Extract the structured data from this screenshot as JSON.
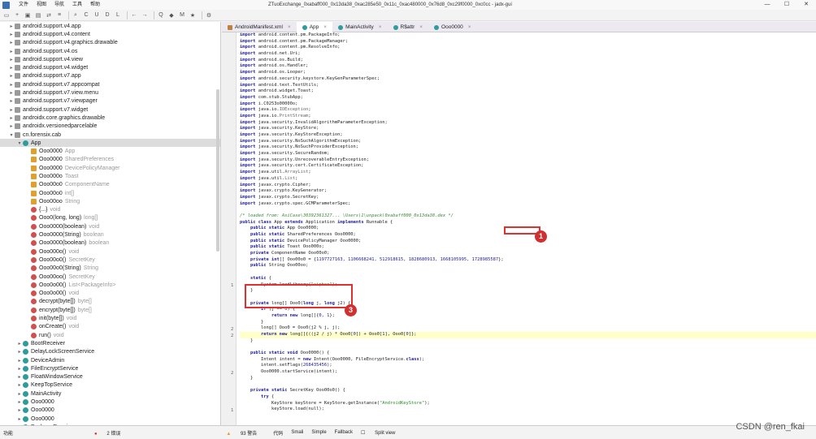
{
  "menu": [
    "文件",
    "视图",
    "导航",
    "工具",
    "帮助"
  ],
  "window_title": "ZTuoExchange_0xabaff000_0x13da38_0xac285e50_0x11c_0xac480000_0x76d8_0xc29f0000_0xc0cc - jadx-gui",
  "tabs": [
    {
      "label": "AndroidManifest.xml"
    },
    {
      "label": "App"
    },
    {
      "label": "MainActivity"
    },
    {
      "label": "R$attr"
    },
    {
      "label": "Ooo0000"
    }
  ],
  "tree": [
    {
      "label": "android.support.v4.app",
      "kind": "pkg",
      "depth": 1,
      "exp": ">"
    },
    {
      "label": "android.support.v4.content",
      "kind": "pkg",
      "depth": 1,
      "exp": ">"
    },
    {
      "label": "android.support.v4.graphics.drawable",
      "kind": "pkg",
      "depth": 1,
      "exp": ">"
    },
    {
      "label": "android.support.v4.os",
      "kind": "pkg",
      "depth": 1,
      "exp": ">"
    },
    {
      "label": "android.support.v4.view",
      "kind": "pkg",
      "depth": 1,
      "exp": ">"
    },
    {
      "label": "android.support.v4.widget",
      "kind": "pkg",
      "depth": 1,
      "exp": ">"
    },
    {
      "label": "android.support.v7.app",
      "kind": "pkg",
      "depth": 1,
      "exp": ">"
    },
    {
      "label": "android.support.v7.appcompat",
      "kind": "pkg",
      "depth": 1,
      "exp": ">"
    },
    {
      "label": "android.support.v7.view.menu",
      "kind": "pkg",
      "depth": 1,
      "exp": ">"
    },
    {
      "label": "android.support.v7.viewpager",
      "kind": "pkg",
      "depth": 1,
      "exp": ">"
    },
    {
      "label": "android.support.v7.widget",
      "kind": "pkg",
      "depth": 1,
      "exp": ">"
    },
    {
      "label": "androidx.core.graphics.drawable",
      "kind": "pkg",
      "depth": 1,
      "exp": ">"
    },
    {
      "label": "androidx.versionedparcelable",
      "kind": "pkg",
      "depth": 1,
      "exp": ">"
    },
    {
      "label": "cn.forensix.cab",
      "kind": "pkg",
      "depth": 1,
      "exp": "v"
    },
    {
      "label": "App",
      "kind": "cls",
      "depth": 2,
      "exp": "v",
      "sel": true
    },
    {
      "label": "Ooo0000",
      "type": "App",
      "kind": "fld",
      "depth": 3
    },
    {
      "label": "Ooo0000",
      "type": "SharedPreferences",
      "kind": "fld",
      "depth": 3
    },
    {
      "label": "Ooo0000",
      "type": "DevicePolicyManager",
      "kind": "fld",
      "depth": 3
    },
    {
      "label": "Ooo000o",
      "type": "Toast",
      "kind": "fld",
      "depth": 3
    },
    {
      "label": "Ooo00o0",
      "type": "ComponentName",
      "kind": "fld",
      "depth": 3
    },
    {
      "label": "Ooo00o0",
      "type": "int[]",
      "kind": "fld",
      "depth": 3
    },
    {
      "label": "Ooo00oo",
      "type": "String",
      "kind": "fld",
      "depth": 3
    },
    {
      "label": "{...}",
      "type": "void",
      "kind": "mth",
      "depth": 3
    },
    {
      "label": "Ooo0(long, long)",
      "type": "long[]",
      "kind": "mth",
      "depth": 3
    },
    {
      "label": "Ooo0000(boolean)",
      "type": "void",
      "kind": "mth",
      "depth": 3
    },
    {
      "label": "Ooo0000(String)",
      "type": "boolean",
      "kind": "mth",
      "depth": 3
    },
    {
      "label": "Ooo0000(boolean)",
      "type": "boolean",
      "kind": "mth",
      "depth": 3
    },
    {
      "label": "Ooo000o()",
      "type": "void",
      "kind": "mth",
      "depth": 3
    },
    {
      "label": "Ooo00o0()",
      "type": "SecretKey",
      "kind": "mth",
      "depth": 3
    },
    {
      "label": "Ooo00o0(String)",
      "type": "String",
      "kind": "mth",
      "depth": 3
    },
    {
      "label": "Ooo00oo()",
      "type": "SecretKey",
      "kind": "mth",
      "depth": 3
    },
    {
      "label": "Ooo0o00()",
      "type": "List<PackageInfo>",
      "kind": "mth",
      "depth": 3
    },
    {
      "label": "Ooo0o00()",
      "type": "void",
      "kind": "mth",
      "depth": 3
    },
    {
      "label": "decrypt(byte[])",
      "type": "byte[]",
      "kind": "mth",
      "depth": 3
    },
    {
      "label": "encrypt(byte[])",
      "type": "byte[]",
      "kind": "mth",
      "depth": 3
    },
    {
      "label": "init(byte[])",
      "type": "void",
      "kind": "mth",
      "depth": 3
    },
    {
      "label": "onCreate()",
      "type": "void",
      "kind": "mth",
      "depth": 3
    },
    {
      "label": "run()",
      "type": "void",
      "kind": "mth",
      "depth": 3
    },
    {
      "label": "BootReceiver",
      "kind": "cls",
      "depth": 2,
      "exp": ">"
    },
    {
      "label": "DelayLockScreenService",
      "kind": "cls",
      "depth": 2,
      "exp": ">"
    },
    {
      "label": "DeviceAdmin",
      "kind": "cls",
      "depth": 2,
      "exp": ">"
    },
    {
      "label": "FileEncryptService",
      "kind": "cls",
      "depth": 2,
      "exp": ">"
    },
    {
      "label": "FloatWindowService",
      "kind": "cls",
      "depth": 2,
      "exp": ">"
    },
    {
      "label": "KeepTopService",
      "kind": "cls",
      "depth": 2,
      "exp": ">"
    },
    {
      "label": "MainActivity",
      "kind": "cls",
      "depth": 2,
      "exp": ">"
    },
    {
      "label": "Ooo0000",
      "kind": "cls",
      "depth": 2,
      "exp": ">"
    },
    {
      "label": "Ooo0000",
      "kind": "cls",
      "depth": 2,
      "exp": ">"
    },
    {
      "label": "Ooo0000",
      "kind": "cls",
      "depth": 2,
      "exp": ">"
    },
    {
      "label": "PackageReceiver",
      "kind": "cls",
      "depth": 2,
      "exp": ">"
    }
  ],
  "code_lines": [
    [
      [
        "kw",
        "import "
      ],
      [
        "",
        "android.content.pm.PackageInfo;"
      ]
    ],
    [
      [
        "kw",
        "import "
      ],
      [
        "",
        "android.content.pm.PackageManager;"
      ]
    ],
    [
      [
        "kw",
        "import "
      ],
      [
        "",
        "android.content.pm.ResolveInfo;"
      ]
    ],
    [
      [
        "kw",
        "import "
      ],
      [
        "",
        "android.net.Uri;"
      ]
    ],
    [
      [
        "kw",
        "import "
      ],
      [
        "",
        "android.os.Build;"
      ]
    ],
    [
      [
        "kw",
        "import "
      ],
      [
        "",
        "android.os.Handler;"
      ]
    ],
    [
      [
        "kw",
        "import "
      ],
      [
        "",
        "android.os.Looper;"
      ]
    ],
    [
      [
        "kw",
        "import "
      ],
      [
        "",
        "android.security.keystore.KeyGenParameterSpec;"
      ]
    ],
    [
      [
        "kw",
        "import "
      ],
      [
        "",
        "android.text.TextUtils;"
      ]
    ],
    [
      [
        "kw",
        "import "
      ],
      [
        "",
        "android.widget.Toast;"
      ]
    ],
    [
      [
        "kw",
        "import "
      ],
      [
        "",
        "com.stub.StubApp;"
      ]
    ],
    [
      [
        "kw",
        "import "
      ],
      [
        "",
        "i.C0253o00000o;"
      ]
    ],
    [
      [
        "kw",
        "import "
      ],
      [
        "",
        "java.io."
      ],
      [
        "ty",
        "IOException"
      ],
      [
        "",
        ";"
      ]
    ],
    [
      [
        "kw",
        "import "
      ],
      [
        "",
        "java.io."
      ],
      [
        "ty",
        "PrintStream"
      ],
      [
        "",
        ";"
      ]
    ],
    [
      [
        "kw",
        "import "
      ],
      [
        "",
        "java.security.InvalidAlgorithmParameterException;"
      ]
    ],
    [
      [
        "kw",
        "import "
      ],
      [
        "",
        "java.security.KeyStore;"
      ]
    ],
    [
      [
        "kw",
        "import "
      ],
      [
        "",
        "java.security.KeyStoreException;"
      ]
    ],
    [
      [
        "kw",
        "import "
      ],
      [
        "",
        "java.security.NoSuchAlgorithmException;"
      ]
    ],
    [
      [
        "kw",
        "import "
      ],
      [
        "",
        "java.security.NoSuchProviderException;"
      ]
    ],
    [
      [
        "kw",
        "import "
      ],
      [
        "",
        "java.security.SecureRandom;"
      ]
    ],
    [
      [
        "kw",
        "import "
      ],
      [
        "",
        "java.security.UnrecoverableEntryException;"
      ]
    ],
    [
      [
        "kw",
        "import "
      ],
      [
        "",
        "java.security.cert.CertificateException;"
      ]
    ],
    [
      [
        "kw",
        "import "
      ],
      [
        "",
        "java.util."
      ],
      [
        "ty",
        "ArrayList"
      ],
      [
        "",
        ";"
      ]
    ],
    [
      [
        "kw",
        "import "
      ],
      [
        "",
        "java.util."
      ],
      [
        "ty",
        "List"
      ],
      [
        "",
        ";"
      ]
    ],
    [
      [
        "kw",
        "import "
      ],
      [
        "",
        "javax.crypto.Cipher;"
      ]
    ],
    [
      [
        "kw",
        "import "
      ],
      [
        "",
        "javax.crypto.KeyGenerator;"
      ]
    ],
    [
      [
        "kw",
        "import "
      ],
      [
        "",
        "javax.crypto.SecretKey;"
      ]
    ],
    [
      [
        "kw",
        "import "
      ],
      [
        "",
        "javax.crypto.spec.GCMParameterSpec;"
      ]
    ],
    [
      [
        "",
        ""
      ]
    ],
    [
      [
        "cm",
        "/* loaded from: AsiCase\\30392361327... \\Users\\1\\unpack\\0xabaff000_0x13da38.dex */"
      ]
    ],
    [
      [
        "kw",
        "public class "
      ],
      [
        "",
        "App "
      ],
      [
        "kw",
        "extends "
      ],
      [
        "",
        "Application "
      ],
      [
        "kw",
        "implements "
      ],
      [
        "",
        "Runnable {"
      ]
    ],
    [
      [
        "",
        "    "
      ],
      [
        "kw",
        "public static "
      ],
      [
        "",
        "App Ooo0000;"
      ]
    ],
    [
      [
        "",
        "    "
      ],
      [
        "kw",
        "public static "
      ],
      [
        "",
        "SharedPreferences Ooo0000;"
      ]
    ],
    [
      [
        "",
        "    "
      ],
      [
        "kw",
        "public static "
      ],
      [
        "",
        "DevicePolicyManager Ooo0000;"
      ]
    ],
    [
      [
        "",
        "    "
      ],
      [
        "kw",
        "public static "
      ],
      [
        "",
        "Toast Ooo000o;"
      ]
    ],
    [
      [
        "",
        "    "
      ],
      [
        "kw",
        "private "
      ],
      [
        "",
        "ComponentName Ooo00o0;"
      ]
    ],
    [
      [
        "",
        "    "
      ],
      [
        "kw",
        "private "
      ],
      [
        "kw",
        "int"
      ],
      [
        "",
        "[] Ooo00o0 = {"
      ],
      [
        "num",
        "1197727163, 1106668241, 512918615, 1828680913, 1668105995, 1728985587"
      ],
      [
        "",
        "};"
      ]
    ],
    [
      [
        "",
        "    "
      ],
      [
        "kw",
        "public "
      ],
      [
        "",
        "String Ooo00oo;"
      ]
    ],
    [
      [
        "",
        ""
      ]
    ],
    [
      [
        "",
        "    "
      ],
      [
        "kw",
        "static "
      ],
      [
        "",
        "{"
      ]
    ],
    [
      [
        "",
        "        System.loadLibrary("
      ],
      [
        "str",
        "\"cipher\""
      ],
      [
        "",
        ");"
      ]
    ],
    [
      [
        "",
        "    }"
      ]
    ],
    [
      [
        "",
        ""
      ]
    ],
    [
      [
        "",
        "    "
      ],
      [
        "kw",
        "private "
      ],
      [
        "",
        "long[] Ooo0("
      ],
      [
        "kw",
        "long "
      ],
      [
        "",
        "j, "
      ],
      [
        "kw",
        "long "
      ],
      [
        "",
        "j2) {"
      ]
    ],
    [
      [
        "",
        "        "
      ],
      [
        "kw",
        "if "
      ],
      [
        "",
        "(j == "
      ],
      [
        "num",
        "0"
      ],
      [
        "",
        ") {"
      ]
    ],
    [
      [
        "",
        "            "
      ],
      [
        "kw",
        "return new "
      ],
      [
        "",
        "long[]{"
      ],
      [
        "num",
        "0"
      ],
      [
        "",
        ", "
      ],
      [
        "num",
        "1"
      ],
      [
        "",
        "};"
      ]
    ],
    [
      [
        "",
        "        }"
      ]
    ],
    [
      [
        "",
        "        long[] Ooo0 = Ooo0(j2 % j, j);"
      ]
    ],
    [
      [
        "",
        "        "
      ],
      [
        "kw",
        "return new "
      ],
      [
        "",
        "long[]{((j2 / j) * Ooo0["
      ],
      [
        "num",
        "0"
      ],
      [
        "",
        "]) + Ooo0["
      ],
      [
        "num",
        "1"
      ],
      [
        "",
        "], Ooo0["
      ],
      [
        "num",
        "0"
      ],
      [
        "",
        "]};"
      ]
    ],
    [
      [
        "",
        "    }"
      ]
    ],
    [
      [
        "",
        ""
      ]
    ],
    [
      [
        "",
        "    "
      ],
      [
        "kw",
        "public static void "
      ],
      [
        "",
        "Ooo0000() {"
      ]
    ],
    [
      [
        "",
        "        Intent intent = "
      ],
      [
        "kw",
        "new "
      ],
      [
        "",
        "Intent(Ooo0000, FileEncryptService."
      ],
      [
        "kw",
        "class"
      ],
      [
        "",
        ");"
      ]
    ],
    [
      [
        "",
        "        intent.setFlags("
      ],
      [
        "num",
        "268435456"
      ],
      [
        "",
        ");"
      ]
    ],
    [
      [
        "",
        "        Ooo0000.startService(intent);"
      ]
    ],
    [
      [
        "",
        "    }"
      ]
    ],
    [
      [
        "",
        ""
      ]
    ],
    [
      [
        "",
        "    "
      ],
      [
        "kw",
        "private static "
      ],
      [
        "",
        "SecretKey Ooo00o0() {"
      ]
    ],
    [
      [
        "",
        "        "
      ],
      [
        "kw",
        "try "
      ],
      [
        "",
        "{"
      ]
    ],
    [
      [
        "",
        "            KeyStore keyStore = KeyStore.getInstance("
      ],
      [
        "str",
        "\"AndroidKeyStore\""
      ],
      [
        "",
        ");"
      ]
    ],
    [
      [
        "",
        "            keyStore.load(null);"
      ]
    ]
  ],
  "highlight_line": 48,
  "line_numbers": [
    {
      "row": 40,
      "n": "1"
    },
    {
      "row": 47,
      "n": "2"
    },
    {
      "row": 48,
      "n": "2"
    },
    {
      "row": 54,
      "n": "2"
    },
    {
      "row": 60,
      "n": "1"
    }
  ],
  "annotations": [
    {
      "n": "1"
    },
    {
      "n": "3"
    }
  ],
  "status": {
    "items": [
      "功能",
      "2 错误",
      "93 警告",
      "代码",
      "Smali",
      "Simple",
      "Fallback",
      "Split view"
    ]
  },
  "watermark": "CSDN @ren_fkai",
  "toolbar_icons": [
    "folder-icon",
    "add-file-icon",
    "save-icon",
    "save-all-icon",
    "sync-tree-icon",
    "flat-view-icon",
    "search-icon",
    "search-class-icon",
    "search-usage-icon",
    "decompile-icon",
    "log-icon",
    "back-icon",
    "forward-icon",
    "quark-icon",
    "deobfuscate-icon",
    "mapping-icon",
    "bookmark-icon",
    "settings-icon"
  ]
}
